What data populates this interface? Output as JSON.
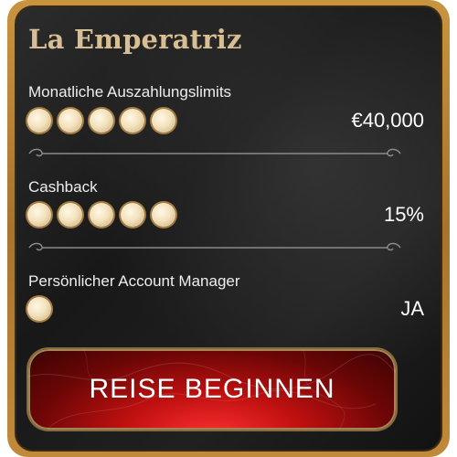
{
  "card": {
    "title": "La Emperatriz",
    "rows": [
      {
        "label": "Monatliche Auszahlungslimits",
        "dots": 5,
        "value": "€40,000"
      },
      {
        "label": "Cashback",
        "dots": 5,
        "value": "15%"
      },
      {
        "label": "Persönlicher Account Manager",
        "dots": 1,
        "value": "JA"
      }
    ],
    "cta_label": "REISE BEGINNEN"
  },
  "colors": {
    "frame_gold": "#c9943f",
    "card_bg": "#1c1c1c",
    "title_gold": "#d8bf93",
    "button_red": "#c01010"
  }
}
